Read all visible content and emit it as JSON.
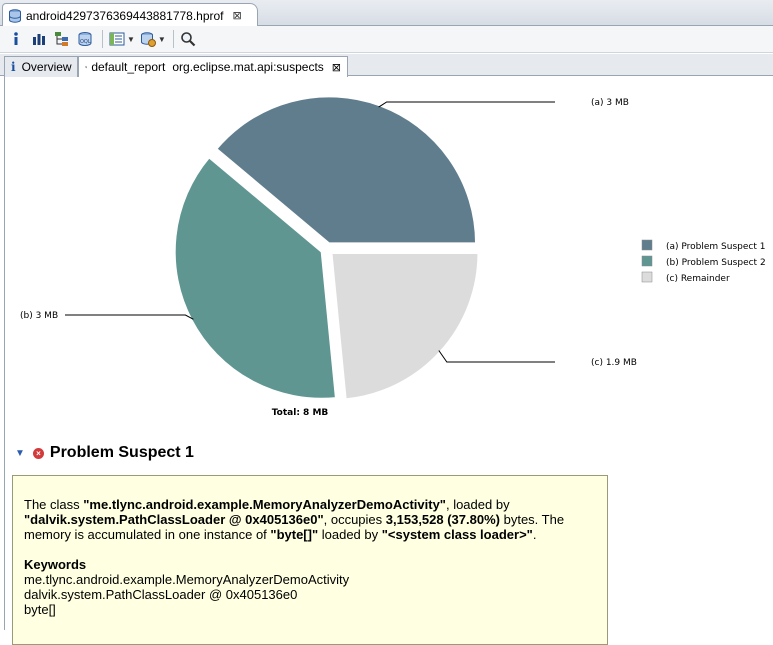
{
  "editor": {
    "tab_title": "android4297376369443881778.hprof",
    "close_glyph": "⊠"
  },
  "toolbar": {
    "buttons": [
      "info-icon",
      "histogram-icon",
      "dominator-tree-icon",
      "oql-icon",
      "query-browser-icon",
      "heap-dump-overview-icon",
      "search-icon"
    ]
  },
  "report_tabs": {
    "overview_label": "Overview",
    "report_label": "default_report",
    "report_subtitle": "org.eclipse.mat.api:suspects",
    "close_glyph": "⊠",
    "info_glyph": "i"
  },
  "chart_data": {
    "type": "pie",
    "title": "",
    "total_label": "Total: 8 MB",
    "slices": [
      {
        "label": "(a)  3 MB",
        "legend": "(a)  Problem Suspect 1",
        "value": 3.15,
        "color": "#607d8e"
      },
      {
        "label": "(b)  3 MB",
        "legend": "(b)  Problem Suspect 2",
        "value": 3.05,
        "color": "#5f9692"
      },
      {
        "label": "(c)  1.9 MB",
        "legend": "(c)  Remainder",
        "value": 1.9,
        "color": "#dcdcdc"
      }
    ]
  },
  "suspect": {
    "title": "Problem Suspect 1",
    "twisty": "▼",
    "error_glyph": "×",
    "p1": "The class ",
    "class_name": "\"me.tlync.android.example.MemoryAnalyzerDemoActivity\"",
    "p2": ", loaded by ",
    "loader": "\"dalvik.system.PathClassLoader @ 0x405136e0\"",
    "p3": ", occupies ",
    "size": "3,153,528 (37.80%)",
    "p4": " bytes. The memory is accumulated in one instance of ",
    "type": "\"byte[]\"",
    "p5": " loaded by ",
    "sys_loader": "\"<system class loader>\"",
    "p6": ".",
    "keywords_title": "Keywords",
    "keywords": [
      "me.tlync.android.example.MemoryAnalyzerDemoActivity",
      "dalvik.system.PathClassLoader @ 0x405136e0",
      "byte[]"
    ]
  }
}
